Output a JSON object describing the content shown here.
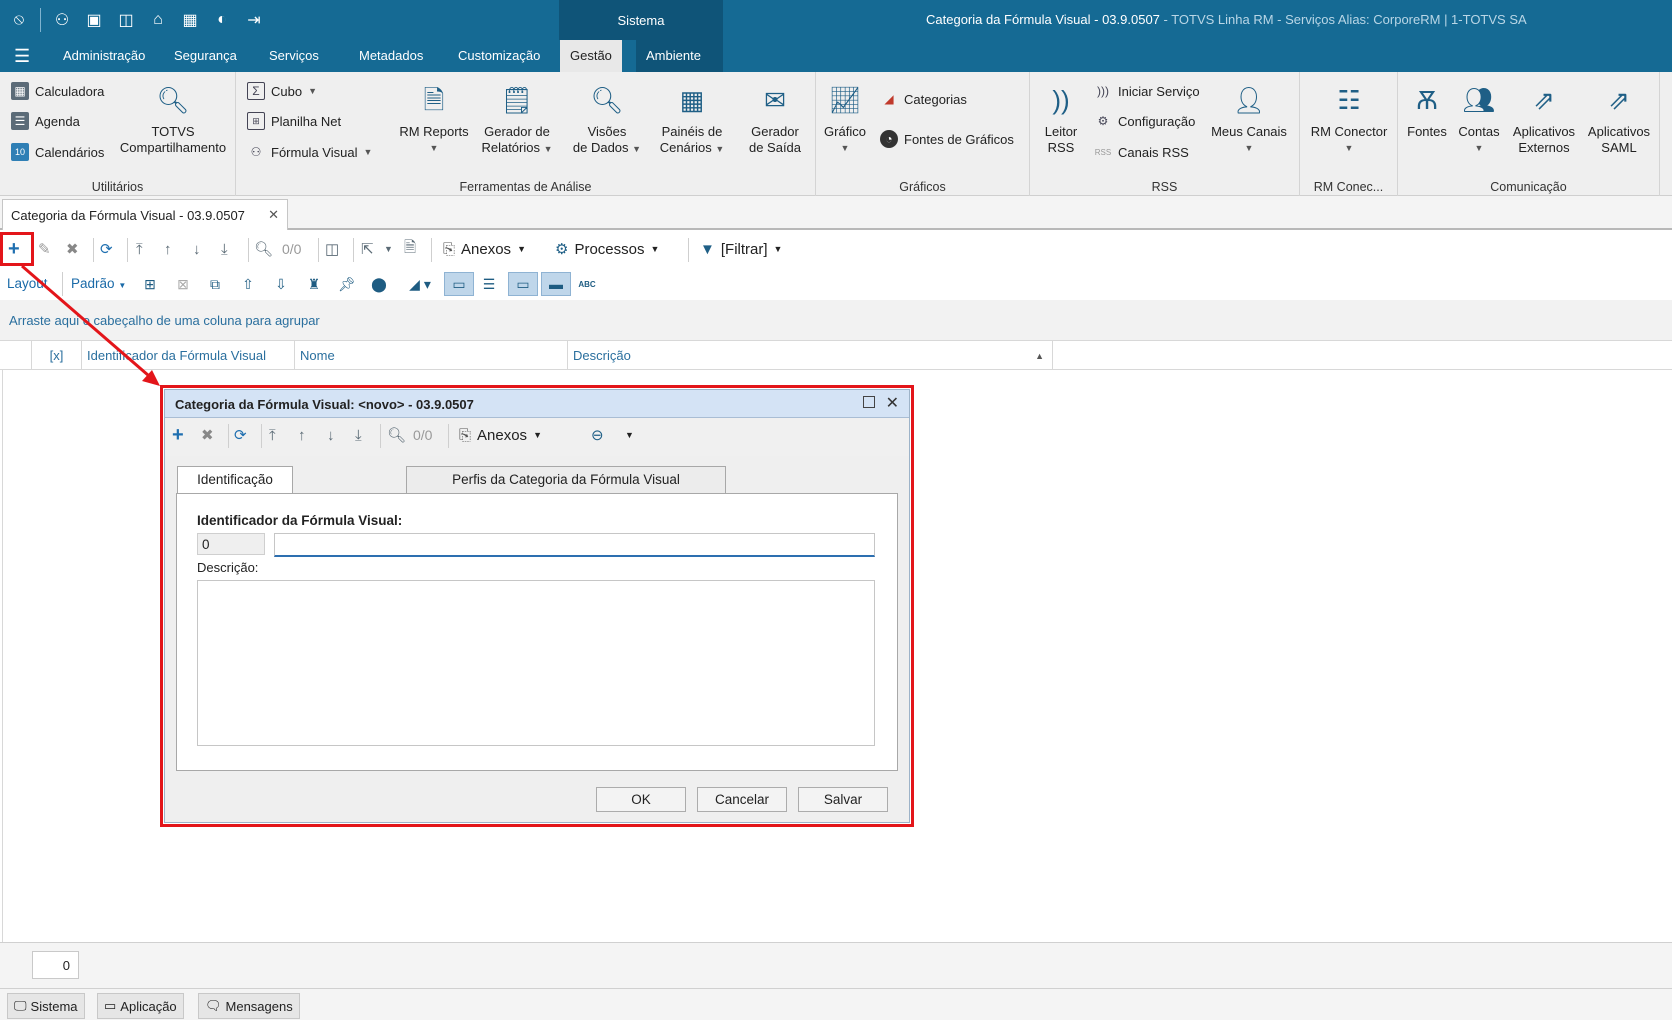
{
  "titlebar": {
    "context_tab": "Sistema",
    "window_title": "Categoria da Fórmula Visual - 03.9.0507",
    "window_title_rest": " - TOTVS Linha RM - Serviços  Alias: CorporeRM | 1-TOTVS SA"
  },
  "ribbon_tabs": [
    "Administração",
    "Segurança",
    "Serviços",
    "Metadados",
    "Customização",
    "Gestão",
    "Ambiente"
  ],
  "ribbon": {
    "utilitarios": {
      "calculadora": "Calculadora",
      "agenda": "Agenda",
      "calendarios": "Calendários",
      "totvs_1": "TOTVS",
      "totvs_2": "Compartilhamento",
      "label": "Utilitários"
    },
    "ferramentas": {
      "cubo": "Cubo",
      "planilha": "Planilha Net",
      "formula": "Fórmula Visual",
      "rmreports": "RM Reports",
      "gerador_1": "Gerador de",
      "gerador_2": "Relatórios",
      "visoes_1": "Visões",
      "visoes_2": "de Dados",
      "paineis_1": "Painéis de",
      "paineis_2": "Cenários",
      "saida_1": "Gerador",
      "saida_2": "de Saída",
      "label": "Ferramentas de Análise"
    },
    "graficos": {
      "grafico": "Gráfico",
      "categorias": "Categorias",
      "fontes": "Fontes de Gráficos",
      "label": "Gráficos"
    },
    "rss": {
      "leitor_1": "Leitor",
      "leitor_2": "RSS",
      "iniciar": "Iniciar Serviço",
      "configuracao": "Configuração",
      "canais": "Canais RSS",
      "meus": "Meus Canais",
      "label": "RSS"
    },
    "rmconector": {
      "btn": "RM Conector",
      "label": "RM Conec..."
    },
    "comunicacao": {
      "fontes": "Fontes",
      "contas": "Contas",
      "ext_1": "Aplicativos",
      "ext_2": "Externos",
      "saml_1": "Aplicativos",
      "saml_2": "SAML",
      "label": "Comunicação"
    }
  },
  "doc_tab": "Categoria da Fórmula Visual - 03.9.0507",
  "toolbar": {
    "nav_count": "0/0",
    "anexos": "Anexos",
    "processos": "Processos",
    "filtrar": "[Filtrar]",
    "layout": "Layout",
    "padrao": "Padrão"
  },
  "group_hint": "Arraste aqui o cabeçalho de uma coluna para agrupar",
  "grid": {
    "columns": [
      "[x]",
      "Identificador da Fórmula Visual",
      "Nome",
      "Descrição"
    ],
    "record_count": "0"
  },
  "statusbar": [
    "Sistema",
    "Aplicação",
    "Mensagens"
  ],
  "dialog": {
    "title": "Categoria da Fórmula Visual: <novo> - 03.9.0507",
    "nav_count": "0/0",
    "anexos": "Anexos",
    "tabs": [
      "Identificação",
      "Perfis da Categoria da Fórmula Visual"
    ],
    "id_label": "Identificador da Fórmula Visual:",
    "id_value": "0",
    "name_value": "",
    "desc_label": "Descrição:",
    "desc_value": "",
    "buttons": {
      "ok": "OK",
      "cancel": "Cancelar",
      "save": "Salvar"
    }
  },
  "colors": {
    "titlebar": "#156a94",
    "context": "#0f5478",
    "highlight": "#e3151a",
    "link": "#2a6f9e"
  }
}
